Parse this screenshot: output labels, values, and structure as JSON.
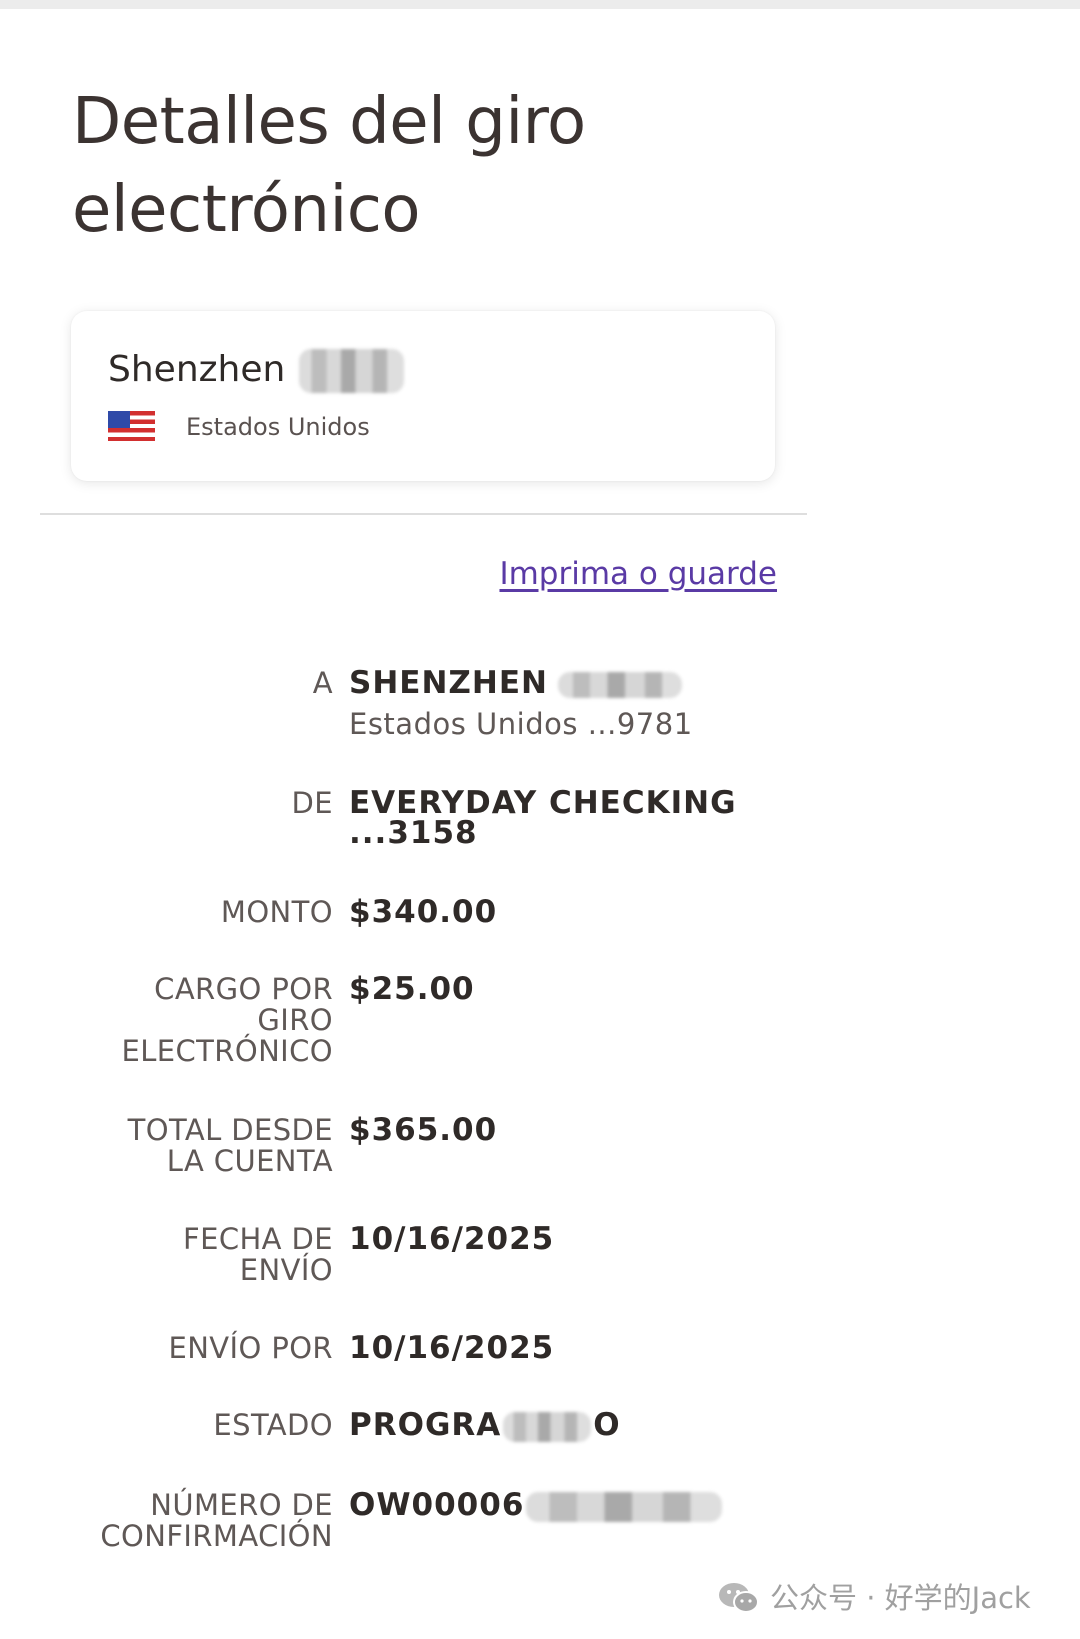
{
  "page": {
    "title": "Detalles del giro electrónico"
  },
  "recipient": {
    "name": "Shenzhen",
    "country": "Estados Unidos",
    "flag_icon": "us-flag-icon"
  },
  "actions": {
    "print_link": "Imprima o guarde"
  },
  "details": [
    {
      "label": "A",
      "value": "SHENZHEN",
      "sub": "Estados Unidos ...9781",
      "redacted": true
    },
    {
      "label": "DE",
      "value": "EVERYDAY CHECKING ...3158"
    },
    {
      "label": "MONTO",
      "value": "$340.00"
    },
    {
      "label": "CARGO POR GIRO ELECTRÓNICO",
      "value": "$25.00"
    },
    {
      "label": "TOTAL DESDE LA CUENTA",
      "value": "$365.00"
    },
    {
      "label": "FECHA DE ENVÍO",
      "value": "10/16/2025"
    },
    {
      "label": "ENVÍO POR",
      "value": "10/16/2025"
    },
    {
      "label": "ESTADO",
      "value_start": "PROGRA",
      "value_end": "O"
    },
    {
      "label": "NÚMERO DE CONFIRMACIÓN",
      "value": "OW00006"
    }
  ],
  "watermark": {
    "text": "公众号 · 好学的Jack",
    "icon": "wechat-icon"
  },
  "colors": {
    "link": "#5a3aa5",
    "text": "#3b3331",
    "label": "#5f5856"
  }
}
